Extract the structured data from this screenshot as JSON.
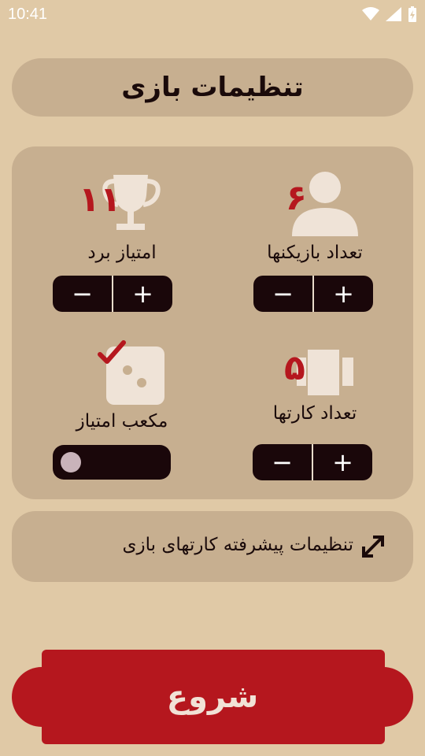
{
  "status_bar": {
    "time": "10:41"
  },
  "title": "تنظیمات بازی",
  "settings": {
    "players": {
      "label": "تعداد بازیکنها",
      "value": "۶",
      "increment": "+",
      "decrement": "−"
    },
    "win_score": {
      "label": "امتیاز برد",
      "value": "۱۱",
      "increment": "+",
      "decrement": "−"
    },
    "cards": {
      "label": "تعداد کارتها",
      "value": "۵",
      "increment": "+",
      "decrement": "−"
    },
    "dice": {
      "label": "مکعب امتیاز",
      "enabled": false
    }
  },
  "advanced": {
    "label": "تنظیمات پیشرفته کارتهای بازی"
  },
  "start_button": {
    "label": "شروع"
  },
  "colors": {
    "background": "#E0C9A6",
    "panel": "#C7AF90",
    "accent_red": "#B5171E",
    "dark": "#1A070A",
    "icon_light": "#EFE3D7"
  }
}
